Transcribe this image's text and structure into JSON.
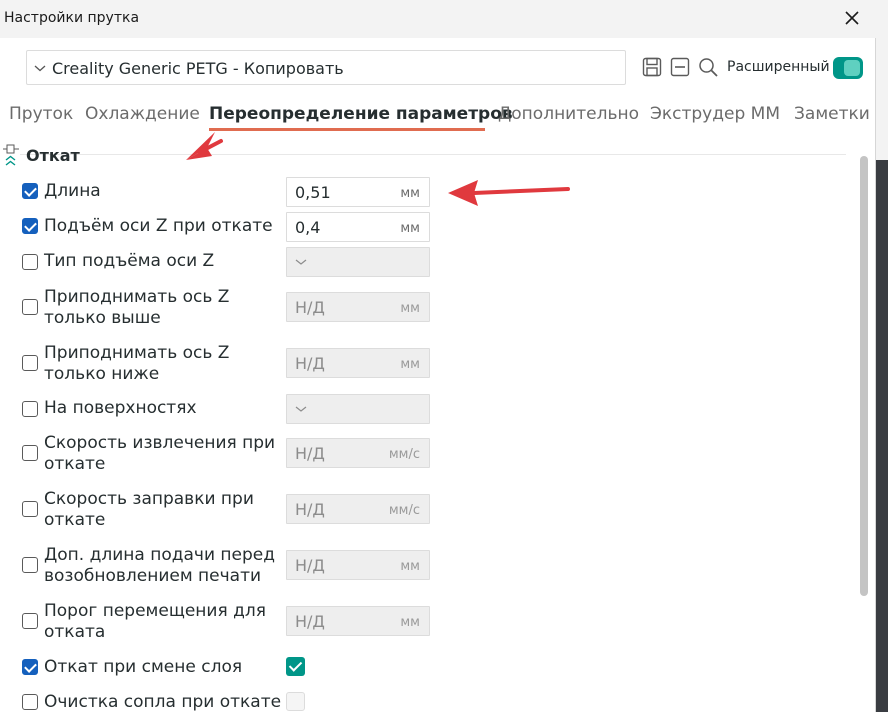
{
  "window": {
    "title": "Настройки прутка"
  },
  "preset": {
    "name": "Creality Generic PETG - Копировать"
  },
  "toolbar": {
    "advanced_label": "Расширенный",
    "advanced_on": true
  },
  "tabs": [
    {
      "label": "Пруток",
      "active": false
    },
    {
      "label": "Охлаждение",
      "active": false
    },
    {
      "label": "Переопределение параметров",
      "active": true
    },
    {
      "label": "Дополнительно",
      "active": false
    },
    {
      "label": "Экструдер ММ",
      "active": false
    },
    {
      "label": "Заметки",
      "active": false
    }
  ],
  "section": {
    "title": "Откат"
  },
  "rows": [
    {
      "label": "Длина",
      "checked": true,
      "value": "0,51",
      "unit": "мм"
    },
    {
      "label": "Подъём оси Z при откате",
      "checked": true,
      "value": "0,4",
      "unit": "мм"
    },
    {
      "label": "Тип подъёма оси Z",
      "checked": false
    },
    {
      "label": "Приподнимать ось Z только выше",
      "checked": false,
      "value": "Н/Д",
      "unit": "мм"
    },
    {
      "label": "Приподнимать ось Z только ниже",
      "checked": false,
      "value": "Н/Д",
      "unit": "мм"
    },
    {
      "label": "На поверхностях",
      "checked": false
    },
    {
      "label": "Скорость извлечения при откате",
      "checked": false,
      "value": "Н/Д",
      "unit": "мм/с"
    },
    {
      "label": "Скорость заправки при откате",
      "checked": false,
      "value": "Н/Д",
      "unit": "мм/с"
    },
    {
      "label": "Доп. длина подачи перед возобновлением печати",
      "checked": false,
      "value": "Н/Д",
      "unit": "мм"
    },
    {
      "label": "Порог перемещения для отката",
      "checked": false,
      "value": "Н/Д",
      "unit": "мм"
    },
    {
      "label": "Откат при смене слоя",
      "checked": true,
      "toggle_checked": true
    },
    {
      "label": "Очистка сопла при откате",
      "checked": false,
      "toggle_checked": false
    }
  ],
  "colors": {
    "accent": "#009688",
    "tab_underline": "#e06c50",
    "annotation_arrow": "#e0393e"
  }
}
